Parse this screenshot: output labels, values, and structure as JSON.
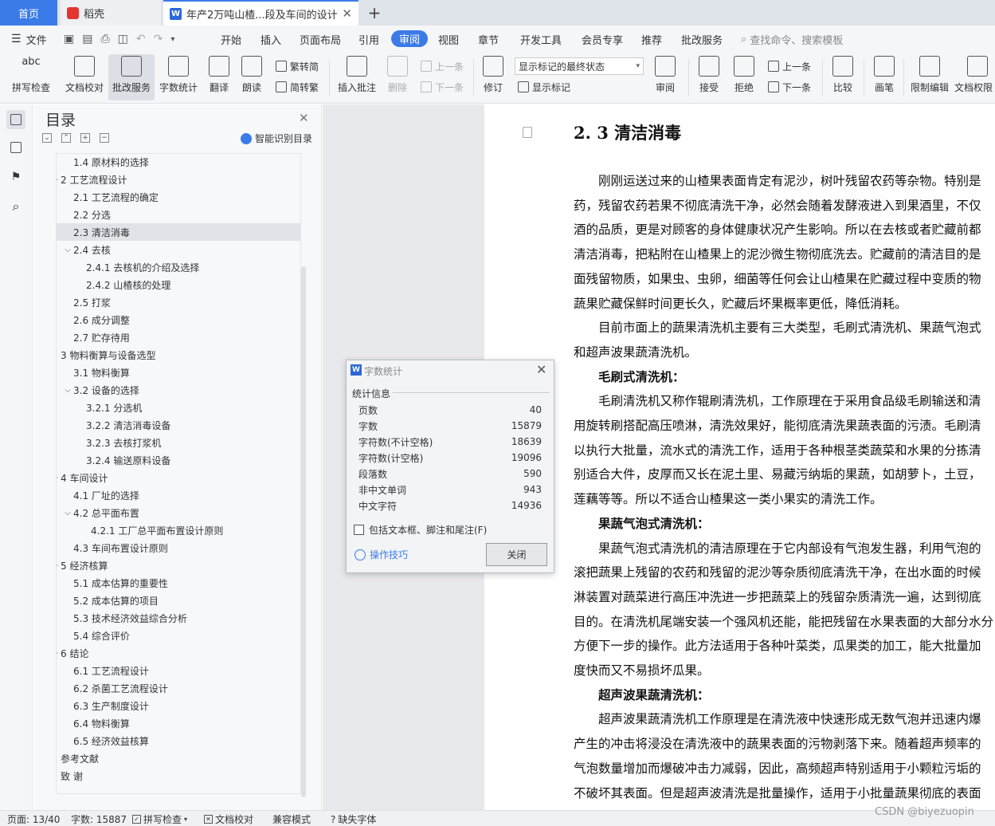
{
  "tabs": {
    "home": "首页",
    "daoke": "稻壳",
    "document": "年产2万吨山楂...段及车间的设计"
  },
  "menu": {
    "file": "文件",
    "items": [
      "开始",
      "插入",
      "页面布局",
      "引用",
      "审阅",
      "视图",
      "章节",
      "开发工具",
      "会员专享",
      "推荐",
      "批改服务"
    ],
    "active": "审阅",
    "search": "查找命令、搜索模板"
  },
  "ribbon": {
    "spell_check": "拼写检查",
    "doc_check": "文档校对",
    "review_service": "批改服务",
    "word_count": "字数统计",
    "translate": "翻译",
    "read_aloud": "朗读",
    "trad_convert": "繁转简",
    "simp_convert": "简转繁",
    "insert_comment": "插入批注",
    "delete": "删除",
    "prev": "上一条",
    "next": "下一条",
    "track_changes": "修订",
    "markup_select": "显示标记的最终状态",
    "show_markup": "显示标记",
    "review": "审阅",
    "accept": "接受",
    "reject": "拒绝",
    "prev2": "上一条",
    "next2": "下一条",
    "compare": "比较",
    "pen": "画笔",
    "restrict_edit": "限制编辑",
    "doc_permission": "文档权限"
  },
  "toc": {
    "title": "目录",
    "smart": "智能识别目录",
    "items": [
      {
        "text": "1.4 原材料的选择",
        "level": 2
      },
      {
        "text": "2 工艺流程设计",
        "level": 1,
        "arrow": "v"
      },
      {
        "text": "2.1 工艺流程的确定",
        "level": 2
      },
      {
        "text": "2.2 分选",
        "level": 2
      },
      {
        "text": "2.3 清洁消毒",
        "level": 2,
        "selected": true
      },
      {
        "text": "2.4 去核",
        "level": 2,
        "arrow": "v"
      },
      {
        "text": "2.4.1 去核机的介绍及选择",
        "level": 3
      },
      {
        "text": "2.4.2 山楂核的处理",
        "level": 3
      },
      {
        "text": "2.5 打浆",
        "level": 2
      },
      {
        "text": "2.6 成分调整",
        "level": 2
      },
      {
        "text": "2.7 贮存待用",
        "level": 2
      },
      {
        "text": "3  物料衡算与设备选型",
        "level": 1,
        "arrow": ">"
      },
      {
        "text": "3.1 物料衡算",
        "level": 2
      },
      {
        "text": "3.2 设备的选择",
        "level": 2,
        "arrow": "v"
      },
      {
        "text": "3.2.1 分选机",
        "level": 3
      },
      {
        "text": "3.2.2 清洁消毒设备",
        "level": 3
      },
      {
        "text": "3.2.3 去核打浆机",
        "level": 3
      },
      {
        "text": "3.2.4 输送原料设备",
        "level": 3
      },
      {
        "text": "4 车间设计",
        "level": 1,
        "arrow": "v"
      },
      {
        "text": "4.1  厂址的选择",
        "level": 2
      },
      {
        "text": "4.2  总平面布置",
        "level": 2,
        "arrow": "v"
      },
      {
        "text": "4.2.1 工厂总平面布置设计原则",
        "level": 4
      },
      {
        "text": "4.3  车间布置设计原则",
        "level": 2
      },
      {
        "text": "5 经济核算",
        "level": 1,
        "arrow": "v"
      },
      {
        "text": "5.1 成本估算的重要性",
        "level": 2
      },
      {
        "text": "5.2 成本估算的项目",
        "level": 2
      },
      {
        "text": "5.3 技术经济效益综合分析",
        "level": 2
      },
      {
        "text": "5.4 综合评价",
        "level": 2
      },
      {
        "text": "6 结论",
        "level": 1,
        "arrow": "v"
      },
      {
        "text": "6.1 工艺流程设计",
        "level": 2
      },
      {
        "text": "6.2 杀菌工艺流程设计",
        "level": 2
      },
      {
        "text": "6.3 生产制度设计",
        "level": 2
      },
      {
        "text": "6.4 物料衡算",
        "level": 2
      },
      {
        "text": "6.5 经济效益核算",
        "level": 2
      },
      {
        "text": "参考文献",
        "level": 1
      },
      {
        "text": "致    谢",
        "level": 1
      }
    ]
  },
  "document": {
    "heading": "2. 3 清洁消毒",
    "lines": [
      {
        "text": "　　刚刚运送过来的山楂果表面肯定有泥沙，树叶残留农药等杂物。特别是",
        "bold": false
      },
      {
        "text": "药，残留农药若果不彻底清洗干净，必然会随着发酵液进入到果酒里，不仅",
        "bold": false
      },
      {
        "text": "酒的品质，更是对顾客的身体健康状况产生影响。所以在去核或者贮藏前都",
        "bold": false
      },
      {
        "text": "清洁消毒，把粘附在山楂果上的泥沙微生物彻底洗去。贮藏前的清洁目的是",
        "bold": false
      },
      {
        "text": "面残留物质，如果虫、虫卵，细菌等任何会让山楂果在贮藏过程中变质的物",
        "bold": false
      },
      {
        "text": "蔬果贮藏保鲜时间更长久，贮藏后坏果概率更低，降低消耗。",
        "bold": false
      },
      {
        "text": "　　目前市面上的蔬果清洗机主要有三大类型，毛刷式清洗机、果蔬气泡式",
        "bold": false
      },
      {
        "text": "和超声波果蔬清洗机。",
        "bold": false
      },
      {
        "text": "　　毛刷式清洗机：",
        "bold": true
      },
      {
        "text": "　　毛刷清洗机又称作辊刷清洗机，工作原理在于采用食品级毛刷输送和清",
        "bold": false
      },
      {
        "text": "用旋转刷搭配高压喷淋，清洗效果好，能彻底清洗果蔬表面的污渍。毛刷清",
        "bold": false
      },
      {
        "text": "以执行大批量，流水式的清洗工作，适用于各种根茎类蔬菜和水果的分拣清",
        "bold": false
      },
      {
        "text": "别适合大件，皮厚而又长在泥土里、易藏污纳垢的果蔬，如胡萝卜，土豆，",
        "bold": false
      },
      {
        "text": "莲藕等等。所以不适合山楂果这一类小果实的清洗工作。",
        "bold": false
      },
      {
        "text": "　　果蔬气泡式清洗机：",
        "bold": true
      },
      {
        "text": "　　果蔬气泡式清洗机的清洁原理在于它内部设有气泡发生器，利用气泡的",
        "bold": false
      },
      {
        "text": "滚把蔬果上残留的农药和残留的泥沙等杂质彻底清洗干净，在出水面的时候",
        "bold": false
      },
      {
        "text": "淋装置对蔬菜进行高压冲洗进一步把蔬菜上的残留杂质清洗一遍，达到彻底",
        "bold": false
      },
      {
        "text": "目的。在清洗机尾端安装一个强风机还能，能把残留在水果表面的大部分水分",
        "bold": false
      },
      {
        "text": "方便下一步的操作。此方法适用于各种叶菜类，瓜果类的加工，能大批量加",
        "bold": false
      },
      {
        "text": "度快而又不易损坏瓜果。",
        "bold": false
      },
      {
        "text": "　　超声波果蔬清洗机：",
        "bold": true
      },
      {
        "text": "　　超声波果蔬清洗机工作原理是在清洗液中快速形成无数气泡并迅速内爆",
        "bold": false
      },
      {
        "text": "产生的冲击将浸没在清洗液中的蔬果表面的污物剥落下来。随着超声频率的",
        "bold": false
      },
      {
        "text": "气泡数量增加而爆破冲击力减弱，因此，高频超声特别适用于小颗粒污垢的",
        "bold": false
      },
      {
        "text": "不破坏其表面。但是超声波清洗是批量操作，适用于小批量蔬果彻底的表面",
        "bold": false
      }
    ]
  },
  "dialog": {
    "title": "字数统计",
    "group": "统计信息",
    "stats": [
      {
        "label": "页数",
        "value": "40"
      },
      {
        "label": "字数",
        "value": "15879"
      },
      {
        "label": "字符数(不计空格)",
        "value": "18639"
      },
      {
        "label": "字符数(计空格)",
        "value": "19096"
      },
      {
        "label": "段落数",
        "value": "590"
      },
      {
        "label": "非中文单词",
        "value": "943"
      },
      {
        "label": "中文字符",
        "value": "14936"
      }
    ],
    "checkbox": "包括文本框、脚注和尾注(F)",
    "tips": "操作技巧",
    "close": "关闭"
  },
  "status": {
    "page": "页面: 13/40",
    "words": "字数: 15887",
    "spell": "拼写检查",
    "doc_check": "文档校对",
    "compat": "兼容模式",
    "missing_font": "缺失字体"
  },
  "watermark": "CSDN @biyezuopin",
  "colors": {
    "accent": "#3b7be8",
    "tabbar": "#dfe3ea",
    "ribbon": "#f5f6f8"
  }
}
